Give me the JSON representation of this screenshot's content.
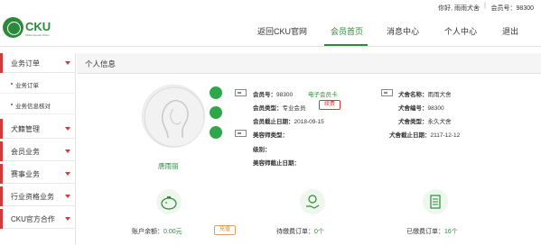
{
  "topbar": {
    "greeting": "你好, 雨雨犬舍",
    "separator": "|",
    "member_no": "会员号：98300"
  },
  "header": {
    "logo_brand": "CKU",
    "logo_tagline": "China Kennel Union",
    "nav": [
      {
        "label": "返回CKU官网"
      },
      {
        "label": "会员首页",
        "active": true
      },
      {
        "label": "消息中心"
      },
      {
        "label": "个人中心"
      },
      {
        "label": "退出"
      }
    ]
  },
  "sidebar": {
    "sections": [
      {
        "label": "业务订单"
      },
      {
        "label": "犬籍管理"
      },
      {
        "label": "会员业务"
      },
      {
        "label": "赛事业务"
      },
      {
        "label": "行业资格业务"
      },
      {
        "label": "CKU官方合作"
      }
    ],
    "subitems": [
      {
        "label": "业务订单"
      },
      {
        "label": "业务信息核对"
      }
    ]
  },
  "panel": {
    "title": "个人信息",
    "avatar_name": "唐雨丽"
  },
  "member_info": {
    "member_no_label": "会员号：",
    "member_no": "98300",
    "e_card": "电子会员卡",
    "type_label": "会员类型：",
    "type": "专业会员",
    "renew": "续费",
    "expire_label": "会员截止日期：",
    "expire": "2018-09-15",
    "groomer_type_label": "美容师类型：",
    "level_label": "级别：",
    "groomer_expire_label": "美容师截止日期："
  },
  "kennel_info": {
    "name_label": "犬舍名称：",
    "name": "雨雨犬舍",
    "no_label": "犬舍编号：",
    "no": "98300",
    "type_label": "犬舍类型：",
    "type": "永久犬舍",
    "expire_label": "犬舍截止日期：",
    "expire": "2117-12-12"
  },
  "stats": {
    "balance_label": "账户余额：",
    "balance": "0.00元",
    "recharge": "充值",
    "pending_label": "待缴费订单：",
    "pending": "0个",
    "paid_label": "已缴费订单：",
    "paid": "16个"
  },
  "colors": {
    "brand_green": "#2a8a3a",
    "accent_red": "#d23b3b",
    "status_green": "#2fa64a"
  }
}
